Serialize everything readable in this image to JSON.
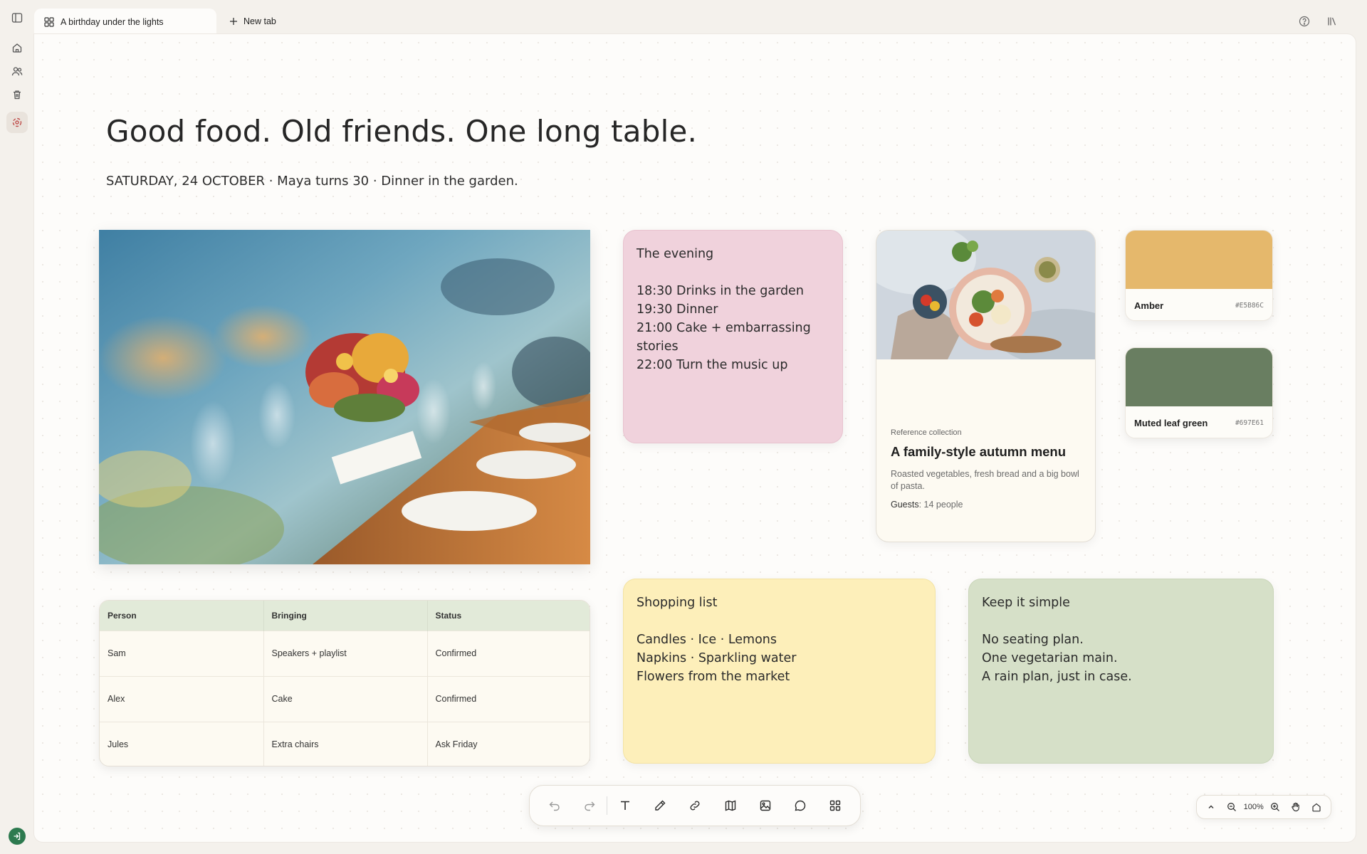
{
  "tabs": {
    "active_title": "A birthday under the lights",
    "new_tab_label": "New tab"
  },
  "rail": {
    "icons": [
      "sidebar-toggle-icon",
      "home-icon",
      "people-icon",
      "trash-icon",
      "canvas-icon"
    ]
  },
  "page": {
    "headline": "Good food. Old friends. One long table.",
    "subline": "SATURDAY, 24 OCTOBER · Maya turns 30 · Dinner in the garden."
  },
  "notes": {
    "evening": {
      "title": "The evening",
      "lines": [
        "18:30 Drinks in the garden",
        "19:30 Dinner",
        "21:00 Cake + embarrassing stories",
        "22:00 Turn the music up"
      ]
    },
    "shopping": {
      "title": "Shopping list",
      "lines": [
        "Candles · Ice · Lemons",
        "Napkins · Sparkling water",
        "Flowers from the market"
      ]
    },
    "simple": {
      "title": "Keep it simple",
      "lines": [
        "No seating plan.",
        "One vegetarian main.",
        "A rain plan, just in case."
      ]
    }
  },
  "reference": {
    "kicker": "Reference collection",
    "title": "A family-style autumn menu",
    "description": "Roasted vegetables, fresh bread and a big bowl of pasta.",
    "meta_label": "Guests",
    "meta_value": ": 14 people"
  },
  "swatches": [
    {
      "name": "Amber",
      "hex": "#E5B86C",
      "color": "#e5b86c"
    },
    {
      "name": "Muted leaf green",
      "hex": "#697E61",
      "color": "#697e61"
    }
  ],
  "table": {
    "headers": [
      "Person",
      "Bringing",
      "Status"
    ],
    "rows": [
      [
        "Sam",
        "Speakers + playlist",
        "Confirmed"
      ],
      [
        "Alex",
        "Cake",
        "Confirmed"
      ],
      [
        "Jules",
        "Extra chairs",
        "Ask Friday"
      ]
    ]
  },
  "toolbar": {
    "tools": [
      "undo-icon",
      "redo-icon",
      "text-icon",
      "pen-icon",
      "link-icon",
      "map-icon",
      "image-icon",
      "comment-icon",
      "grid-icon"
    ]
  },
  "zoom": {
    "level": "100%"
  },
  "colors": {
    "pink_note": "#f0d2dc",
    "yellow_note": "#fdefba",
    "green_note": "#d6e0c8",
    "table_header": "#e2ead9",
    "signin_badge": "#2d7a4f"
  }
}
